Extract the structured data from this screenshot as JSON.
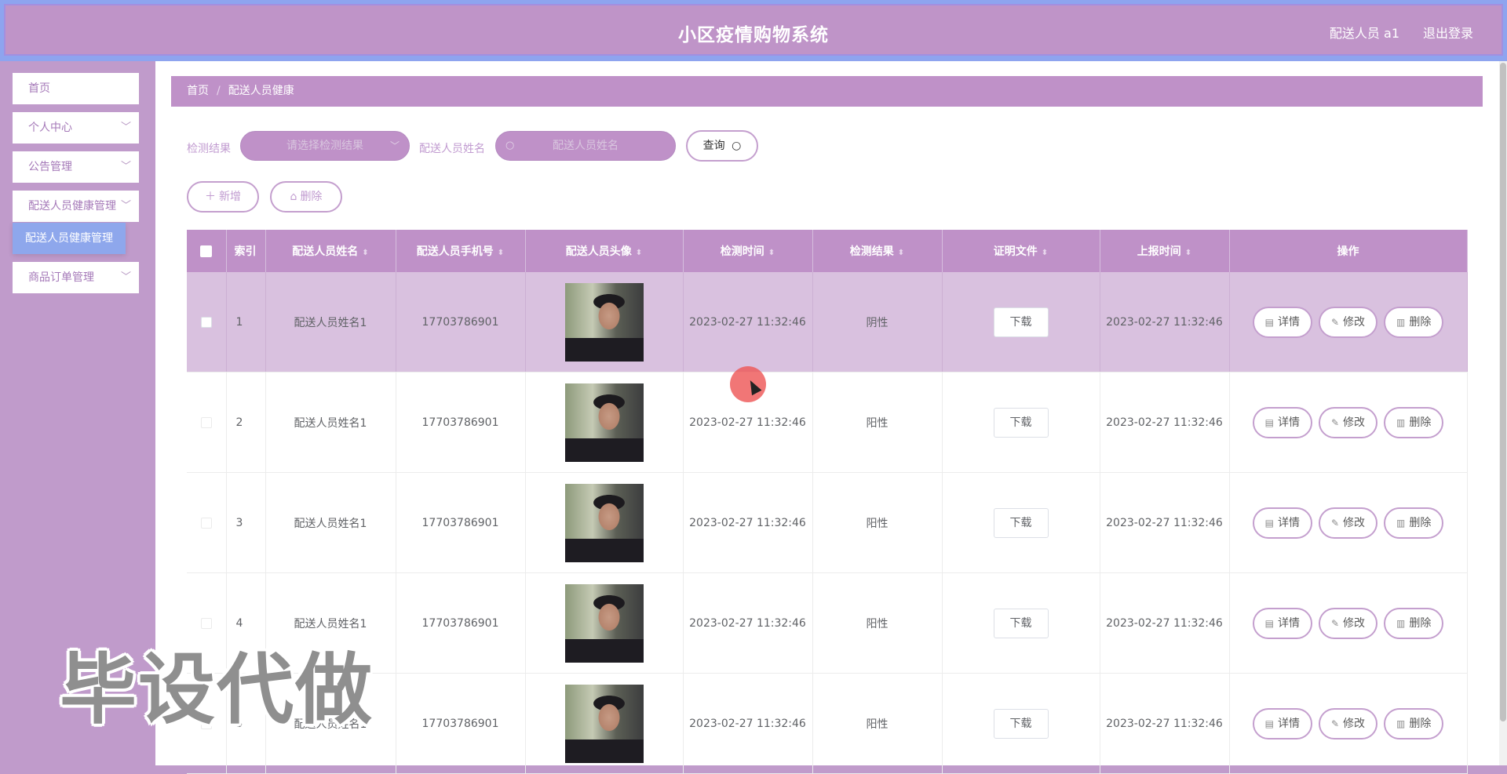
{
  "header": {
    "title": "小区疫情购物系统",
    "user": "配送人员 a1",
    "logout": "退出登录"
  },
  "sidebar": {
    "items": [
      {
        "label": "首页"
      },
      {
        "label": "个人中心"
      },
      {
        "label": "公告管理"
      },
      {
        "label": "配送人员健康管理"
      },
      {
        "label": "商品订单管理"
      }
    ],
    "submenu": {
      "label": "配送人员健康管理"
    }
  },
  "breadcrumb": {
    "home": "首页",
    "sep": "/",
    "current": "配送人员健康"
  },
  "search": {
    "result_label": "检测结果",
    "result_placeholder": "请选择检测结果",
    "name_label": "配送人员姓名",
    "name_placeholder": "配送人员姓名",
    "query_label": "查询"
  },
  "toolbar": {
    "add_label": "新增",
    "delete_label": "删除"
  },
  "table": {
    "columns": [
      "索引",
      "配送人员姓名",
      "配送人员手机号",
      "配送人员头像",
      "检测时间",
      "检测结果",
      "证明文件",
      "上报时间",
      "操作"
    ],
    "download_label": "下载",
    "actions": {
      "detail": "详情",
      "edit": "修改",
      "delete": "删除"
    },
    "rows": [
      {
        "index": "1",
        "name": "配送人员姓名1",
        "phone": "17703786901",
        "check_time": "2023-02-27 11:32:46",
        "result": "阴性",
        "report_time": "2023-02-27 11:32:46"
      },
      {
        "index": "2",
        "name": "配送人员姓名1",
        "phone": "17703786901",
        "check_time": "2023-02-27 11:32:46",
        "result": "阳性",
        "report_time": "2023-02-27 11:32:46"
      },
      {
        "index": "3",
        "name": "配送人员姓名1",
        "phone": "17703786901",
        "check_time": "2023-02-27 11:32:46",
        "result": "阳性",
        "report_time": "2023-02-27 11:32:46"
      },
      {
        "index": "4",
        "name": "配送人员姓名1",
        "phone": "17703786901",
        "check_time": "2023-02-27 11:32:46",
        "result": "阳性",
        "report_time": "2023-02-27 11:32:46"
      },
      {
        "index": "5",
        "name": "配送人员姓名1",
        "phone": "17703786901",
        "check_time": "2023-02-27 11:32:46",
        "result": "阳性",
        "report_time": "2023-02-27 11:32:46"
      }
    ]
  },
  "watermark": "毕设代做",
  "colors": {
    "primary": "#bf91c8",
    "accent_blue": "#8ea7ec",
    "border": "#c49fce"
  },
  "icons": {
    "search": "search-icon",
    "plus": "plus-icon",
    "trash": "trash-icon",
    "doc": "document-icon",
    "edit": "edit-icon",
    "chevron": "chevron-down-icon"
  }
}
